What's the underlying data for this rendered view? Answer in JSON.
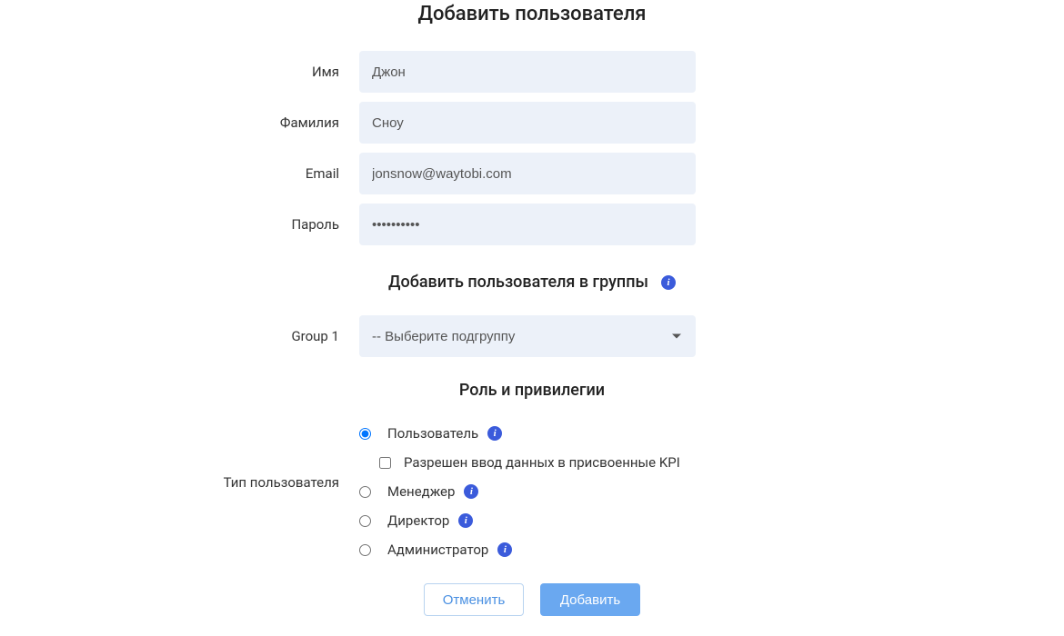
{
  "title": "Добавить пользователя",
  "fields": {
    "firstName": {
      "label": "Имя",
      "value": "Джон"
    },
    "lastName": {
      "label": "Фамилия",
      "value": "Сноу"
    },
    "email": {
      "label": "Email",
      "value": "jonsnow@waytobi.com"
    },
    "password": {
      "label": "Пароль",
      "value": "••••••••••"
    }
  },
  "groups": {
    "header": "Добавить пользователя в группы",
    "group1": {
      "label": "Group 1",
      "selected": "-- Выберите подгруппу"
    }
  },
  "roles": {
    "header": "Роль и привилегии",
    "typeLabel": "Тип пользователя",
    "options": {
      "user": "Пользователь",
      "userKpi": "Разрешен ввод данных в присвоенные KPI",
      "manager": "Менеджер",
      "director": "Директор",
      "admin": "Администратор"
    }
  },
  "buttons": {
    "cancel": "Отменить",
    "submit": "Добавить"
  },
  "info_glyph": "i"
}
